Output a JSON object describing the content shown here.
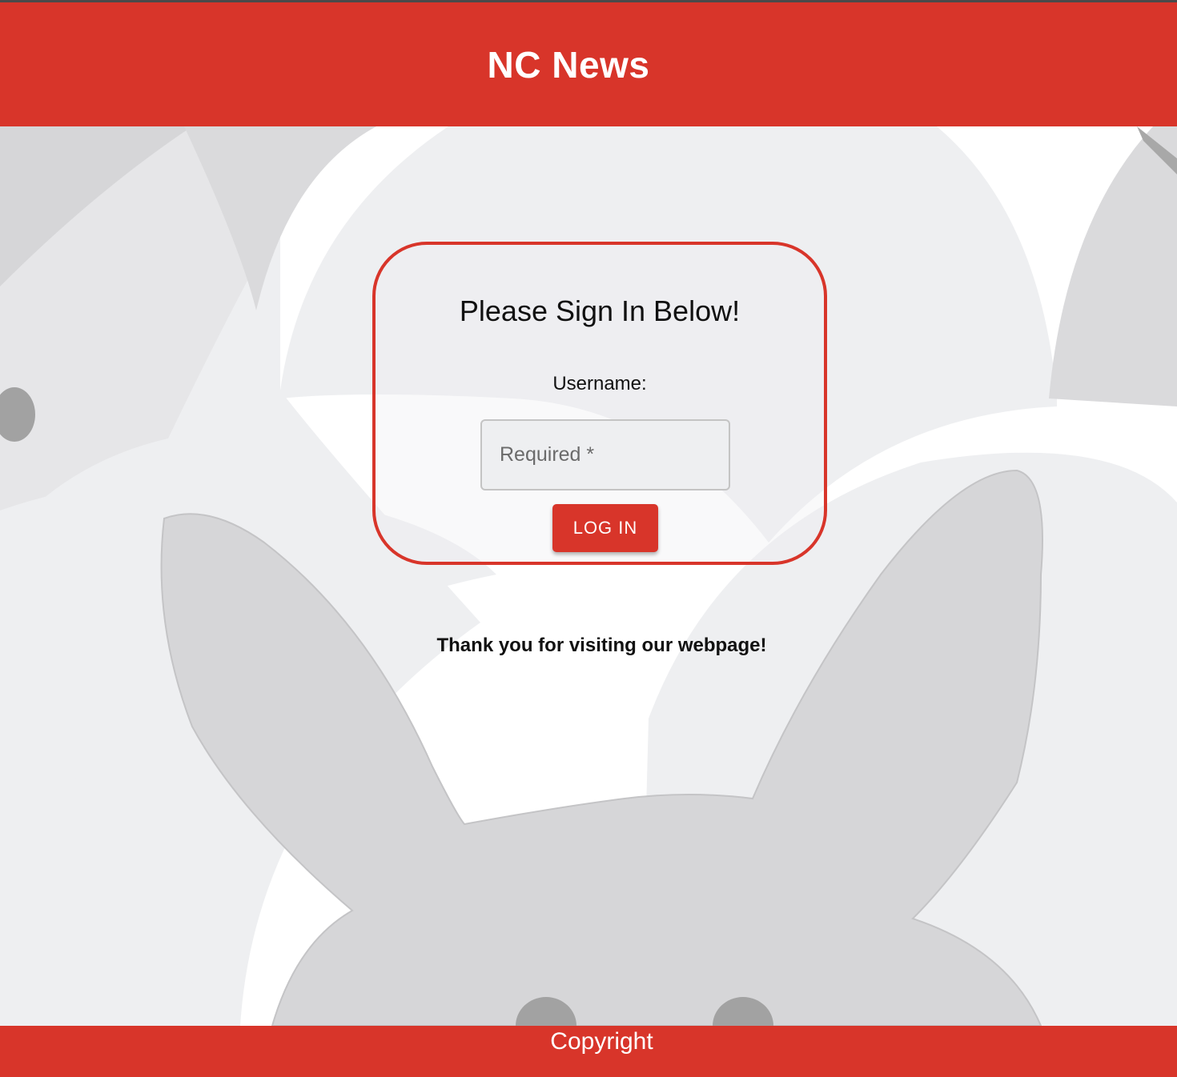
{
  "header": {
    "title": "NC News"
  },
  "login": {
    "heading": "Please Sign In Below!",
    "username_label": "Username:",
    "username_placeholder": "Required *",
    "username_value": "",
    "button_label": "LOG IN"
  },
  "main": {
    "thanks_text": "Thank you for visiting our webpage!"
  },
  "footer": {
    "text": "Copyright"
  },
  "colors": {
    "brand_red": "#d8352a",
    "background_light": "#eeeff1",
    "pattern_gray": "#d8d8da"
  }
}
